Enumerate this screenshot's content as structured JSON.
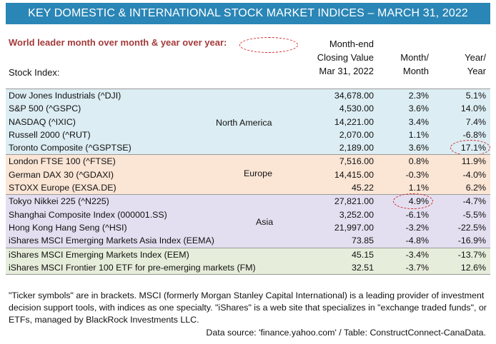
{
  "title": "KEY DOMESTIC & INTERNATIONAL STOCK MARKET INDICES – MARCH 31, 2022",
  "leader_label": "World leader month over month & year over year:",
  "headers": {
    "index": "Stock Index:",
    "close": [
      "Month-end",
      "Closing Value",
      "Mar 31, 2022"
    ],
    "month": [
      "Month/",
      "Month"
    ],
    "year": [
      "Year/",
      "Year"
    ]
  },
  "colors": {
    "banner": "#2a86b6",
    "leader_text": "#a33a3a",
    "north_america": "#dcedf3",
    "europe": "#fbe5d5",
    "asia": "#e3dff0",
    "emerging": "#e6eedb",
    "highlight": "#d42020"
  },
  "chart_data": {
    "type": "table",
    "title": "KEY DOMESTIC & INTERNATIONAL STOCK MARKET INDICES – MARCH 31, 2022",
    "columns": [
      "Stock Index:",
      "Month-end Closing Value Mar 31, 2022",
      "Month/ Month",
      "Year/ Year"
    ],
    "groups": [
      {
        "region": "North America",
        "rows": [
          {
            "name": "Dow Jones Industrials (^DJI)",
            "close": "34,678.00",
            "month": "2.3%",
            "year": "5.1%"
          },
          {
            "name": "S&P 500 (^GSPC)",
            "close": "4,530.00",
            "month": "3.6%",
            "year": "14.0%"
          },
          {
            "name": "NASDAQ (^IXIC)",
            "close": "14,221.00",
            "month": "3.4%",
            "year": "7.4%"
          },
          {
            "name": "Russell  2000 (^RUT)",
            "close": "2,070.00",
            "month": "1.1%",
            "year": "-6.8%"
          },
          {
            "name": "Toronto Composite (^GSPTSE)",
            "close": "2,189.00",
            "month": "3.6%",
            "year": "17.1%"
          }
        ]
      },
      {
        "region": "Europe",
        "rows": [
          {
            "name": "London FTSE 100 (^FTSE)",
            "close": "7,516.00",
            "month": "0.8%",
            "year": "11.9%"
          },
          {
            "name": "German DAX 30 (^GDAXI)",
            "close": "14,415.00",
            "month": "-0.3%",
            "year": "-4.0%"
          },
          {
            "name": "STOXX Europe (EXSA.DE)",
            "close": "45.22",
            "month": "1.1%",
            "year": "6.2%"
          }
        ]
      },
      {
        "region": "Asia",
        "rows": [
          {
            "name": "Tokyo Nikkei 225 (^N225)",
            "close": "27,821.00",
            "month": "4.9%",
            "year": "-4.7%"
          },
          {
            "name": "Shanghai Composite Index (000001.SS)",
            "close": "3,252.00",
            "month": "-6.1%",
            "year": "-5.5%"
          },
          {
            "name": "Hong Kong Hang Seng (^HSI)",
            "close": "21,997.00",
            "month": "-3.2%",
            "year": "-22.5%"
          },
          {
            "name": "iShares MSCI Emerging Markets Asia Index (EEMA)",
            "close": "73.85",
            "month": "-4.8%",
            "year": "-16.9%"
          }
        ]
      },
      {
        "region": "",
        "rows": [
          {
            "name": "iShares MSCI Emerging Markets Index (EEM)",
            "close": "45.15",
            "month": "-3.4%",
            "year": "-13.7%"
          },
          {
            "name": "iShares MSCI Frontier 100 ETF for pre-emerging markets (FM)",
            "close": "32.51",
            "month": "-3.7%",
            "year": "12.6%"
          }
        ]
      }
    ],
    "highlights": [
      {
        "column": "month",
        "value": "4.9%"
      },
      {
        "column": "year",
        "value": "17.1%"
      }
    ]
  },
  "footnote": "\"Ticker symbols\" are in brackets. MSCI (formerly Morgan Stanley Capital International) is a leading provider of investment decision support tools, with indices as one specialty. \"iShares\" is a web site that specializes in \"exchange traded funds\", or ETFs, managed by BlackRock Investments LLC.",
  "source": "Data source: 'finance.yahoo.com' / Table: ConstructConnect-CanaData."
}
